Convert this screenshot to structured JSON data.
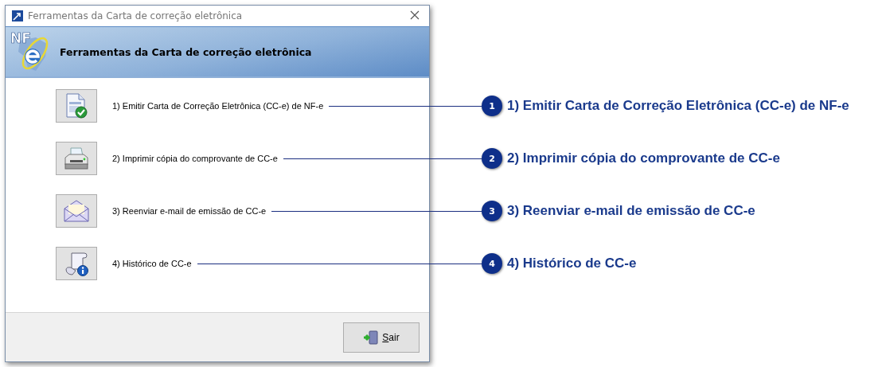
{
  "window": {
    "title": "Ferramentas da Carta de correção eletrônica"
  },
  "banner": {
    "logo": "NF",
    "title": "Ferramentas da Carta de correção eletrônica"
  },
  "actions": [
    {
      "kind": "document",
      "label": "1) Emitir Carta de Correção Eletrônica (CC-e) de NF-e",
      "badge": "1",
      "callout": "1) Emitir Carta de Correção Eletrônica (CC-e) de NF-e"
    },
    {
      "kind": "printer",
      "label": "2) Imprimir cópia do comprovante de CC-e",
      "badge": "2",
      "callout": "2) Imprimir cópia do comprovante de CC-e"
    },
    {
      "kind": "mail",
      "label": "3) Reenviar e-mail de emissão de CC-e",
      "badge": "3",
      "callout": "3) Reenviar e-mail de emissão de CC-e"
    },
    {
      "kind": "history",
      "label": "4) Histórico de CC-e",
      "badge": "4",
      "callout": "4) Histórico de CC-e"
    }
  ],
  "exit_button": {
    "label": "Sair"
  }
}
